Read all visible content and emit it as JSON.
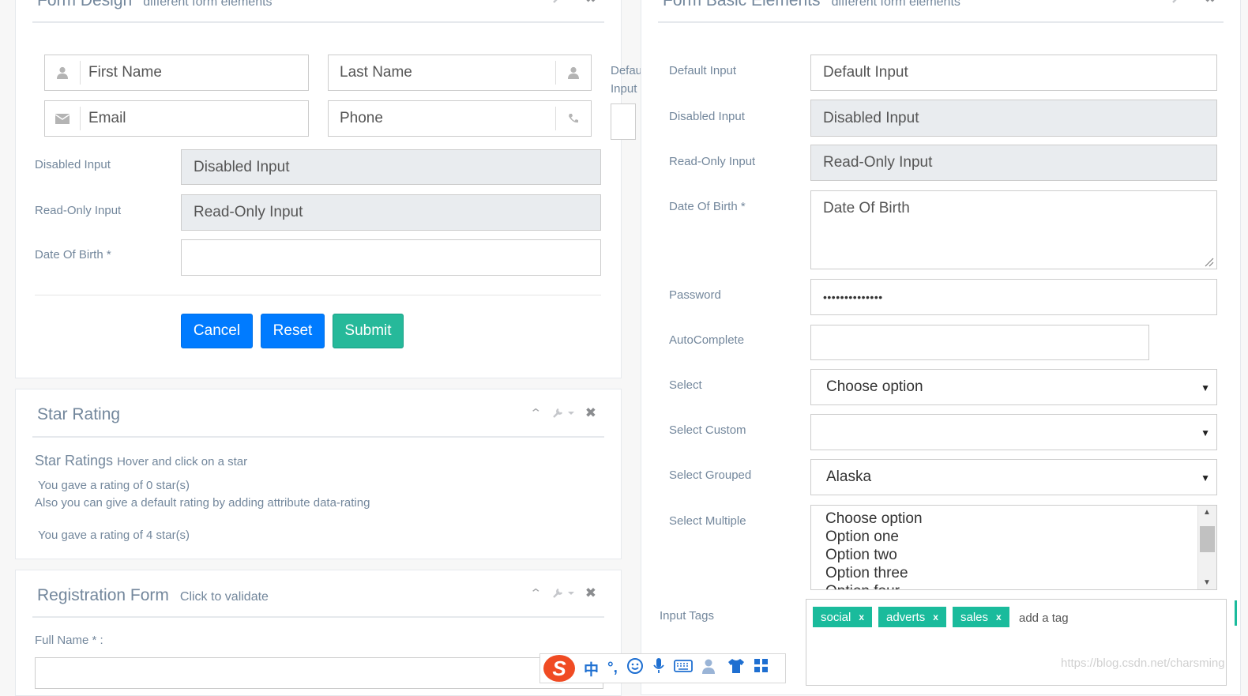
{
  "form_design": {
    "title": "Form Design",
    "subtitle": "different form elements",
    "first_name_placeholder": "First Name",
    "last_name_placeholder": "Last Name",
    "email_placeholder": "Email",
    "phone_placeholder": "Phone",
    "disabled_label": "Disabled Input",
    "disabled_value": "Disabled Input",
    "readonly_label": "Read-Only Input",
    "readonly_value": "Read-Only Input",
    "dob_label": "Date Of Birth *",
    "cancel": "Cancel",
    "reset": "Reset",
    "submit": "Submit"
  },
  "partial_label": {
    "line1": "Defau",
    "line2": "Input"
  },
  "star_rating": {
    "title": "Star Rating",
    "heading": "Star Ratings",
    "heading_small": "Hover and click on a star",
    "rating_text_1": "You gave a rating of 0 star(s)",
    "default_note": "Also you can give a default rating by adding attribute data-rating",
    "rating_text_2": "You gave a rating of 4 star(s)"
  },
  "registration": {
    "title": "Registration Form",
    "subtitle": "Click to validate",
    "full_name_label": "Full Name * :"
  },
  "basic_elements": {
    "title": "Form Basic Elements",
    "subtitle": "different form elements",
    "default_label": "Default Input",
    "default_placeholder": "Default Input",
    "disabled_label": "Disabled Input",
    "disabled_value": "Disabled Input",
    "readonly_label": "Read-Only Input",
    "readonly_value": "Read-Only Input",
    "dob_label": "Date Of Birth *",
    "dob_placeholder": "Date Of Birth",
    "password_label": "Password",
    "password_value": "••••••••••••••",
    "autocomplete_label": "AutoComplete",
    "select_label": "Select",
    "select_value": "Choose option",
    "select_custom_label": "Select Custom",
    "select_custom_value": "",
    "select_grouped_label": "Select Grouped",
    "select_grouped_value": "Alaska",
    "select_multiple_label": "Select Multiple",
    "multiple_options": [
      "Choose option",
      "Option one",
      "Option two",
      "Option three",
      "Option four"
    ],
    "tags_label": "Input Tags",
    "tags": [
      "social",
      "adverts",
      "sales"
    ],
    "tag_remove": "x",
    "tag_placeholder": "add a tag"
  },
  "ime_toolbar": {
    "logo": "S",
    "chinese": "中",
    "punct": "°,"
  },
  "watermark": "https://blog.csdn.net/charsming"
}
